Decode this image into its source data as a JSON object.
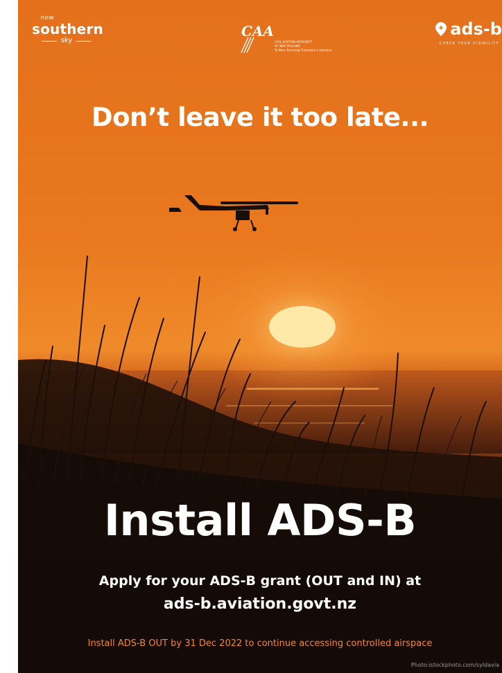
{
  "logos": {
    "new_southern_sky": {
      "new": "new",
      "southern": "southern",
      "sky": "sky"
    },
    "caa": {
      "mark": "CAA",
      "lines": [
        "CIVIL AVIATION AUTHORITY",
        "OF NEW ZEALAND",
        "Te Mana Rererangi Tumatanui o Aotearoa"
      ]
    },
    "adsb": {
      "word": "ads-b",
      "tagline": "CHECK YOUR VISIBILITY",
      "icon": "location-pin-plane-icon"
    }
  },
  "headline": "Don’t leave it too late...",
  "main_title": "Install ADS-B",
  "apply_text": "Apply for your ADS-B grant (OUT and IN) at",
  "url": "ads-b.aviation.govt.nz",
  "deadline_text": "Install ADS-B OUT by 31 Dec 2022 to continue accessing controlled airspace",
  "photo_credit": "Photo:istockphoto.com/syldavia",
  "colors": {
    "sky_orange": "#e7761f",
    "sun": "#ffe9a8",
    "silhouette": "#1a0e08",
    "bottom_band": "#160c07",
    "deadline_text": "#f08a2a",
    "credit_text": "#9a9a9a"
  }
}
